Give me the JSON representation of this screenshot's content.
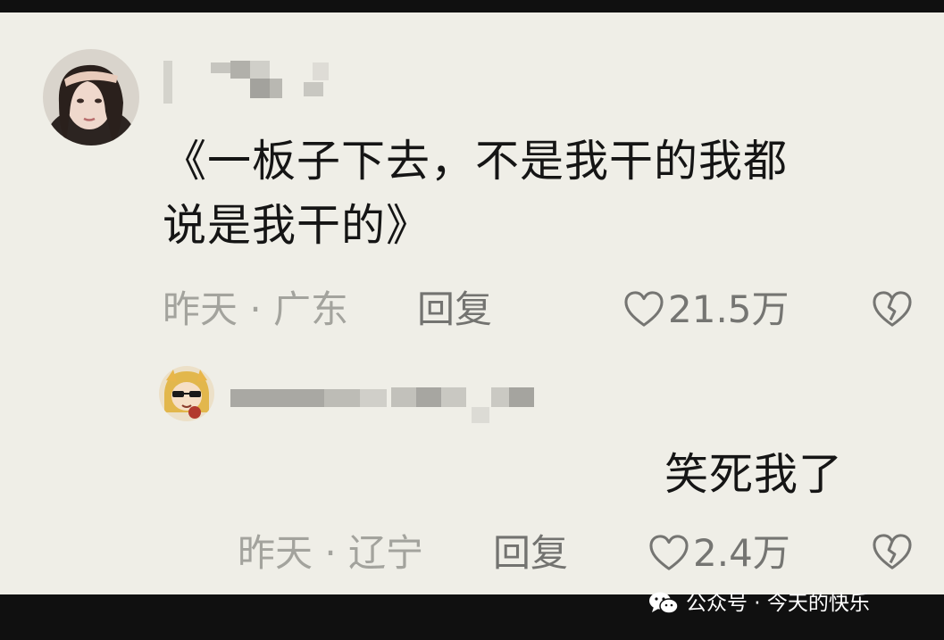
{
  "main_comment": {
    "text_line1": "《一板子下去，不是我干的我都",
    "text_line2": "说是我干的》",
    "meta": "昨天 · 广东",
    "reply_label": "回复",
    "likes": "21.5万",
    "like_icon": "heart-outline-icon",
    "dislike_icon": "broken-heart-icon"
  },
  "reply_comment": {
    "text": "笑死我了",
    "meta": "昨天 · 辽宁",
    "reply_label": "回复",
    "likes": "2.4万",
    "like_icon": "heart-outline-icon",
    "dislike_icon": "broken-heart-icon"
  },
  "watermark": {
    "text": "公众号 · 今天的快乐",
    "icon": "wechat-icon"
  },
  "colors": {
    "background": "#efeee7",
    "primary_text": "#151515",
    "meta_text": "#a3a39d",
    "action_text": "#757572",
    "frame": "#101010"
  }
}
